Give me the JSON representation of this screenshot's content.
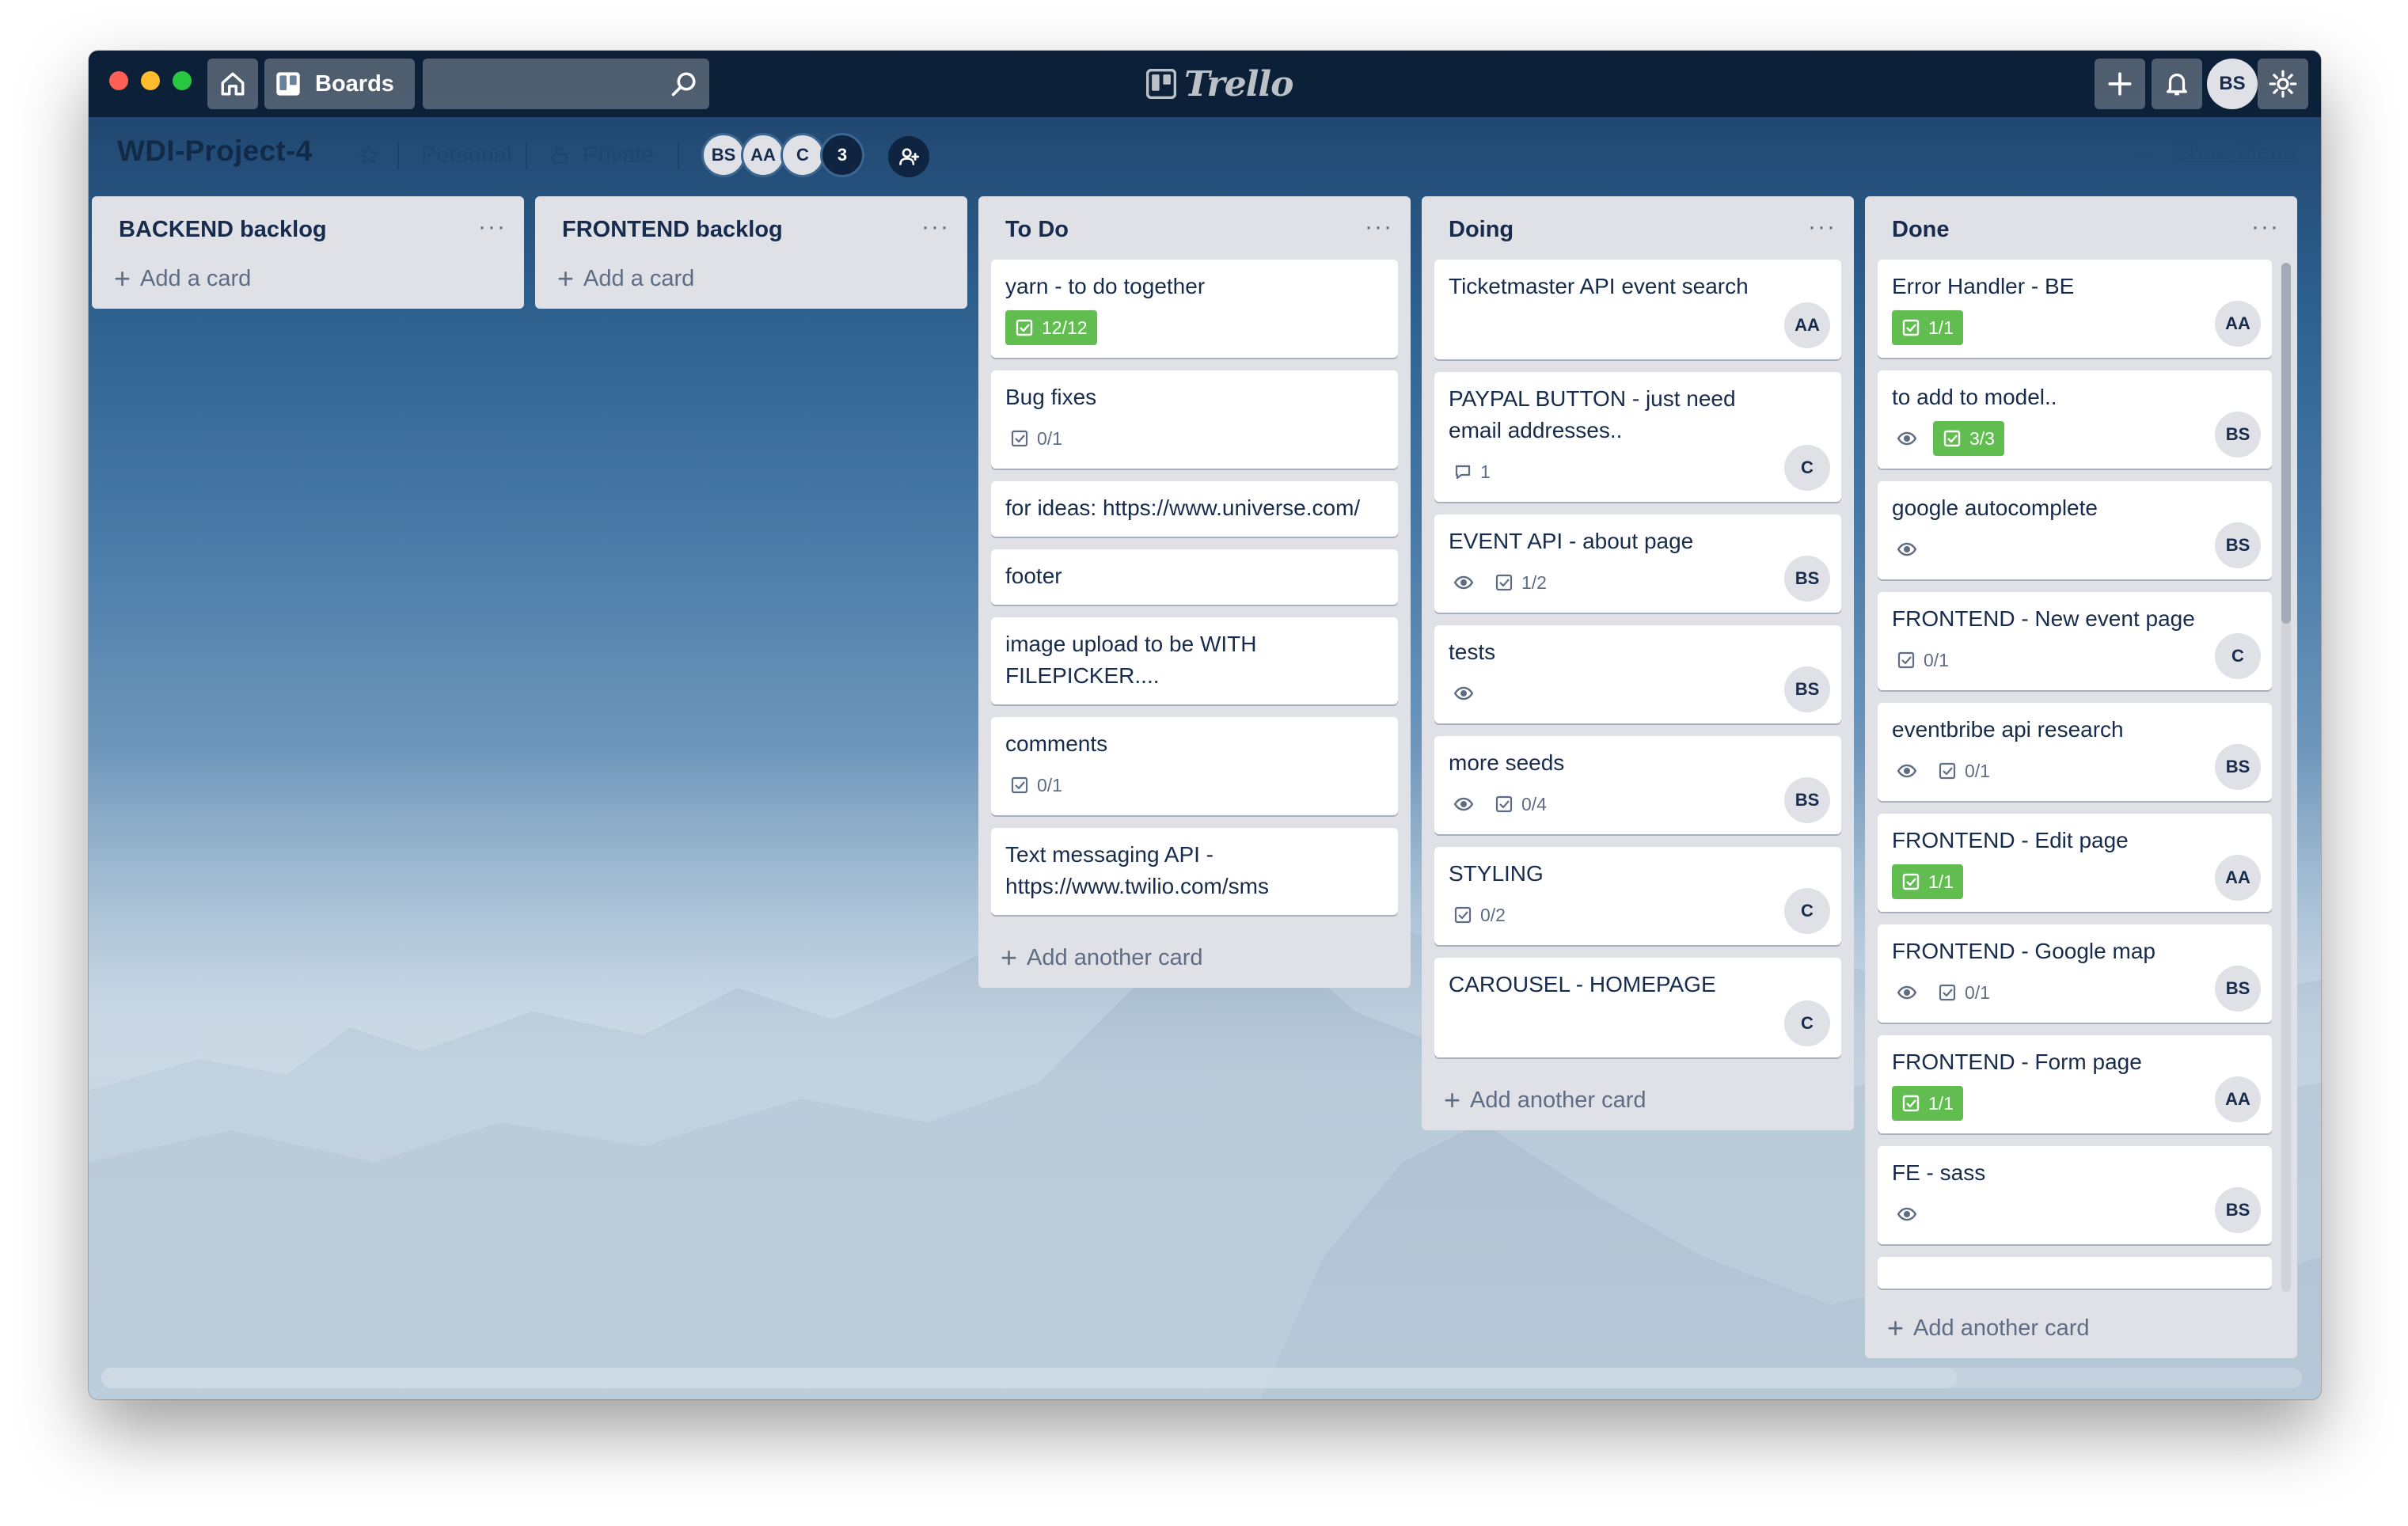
{
  "app": {
    "logo_text": "Trello"
  },
  "topbar": {
    "boards_label": "Boards",
    "search_value": "",
    "search_placeholder": "",
    "user_initials": "BS"
  },
  "board": {
    "title": "WDI-Project-4",
    "team": "Personal",
    "visibility": "Private",
    "members": [
      "BS",
      "AA",
      "C"
    ],
    "member_count": "3",
    "show_menu": "Show Menu"
  },
  "lists": [
    {
      "title": "BACKEND backlog",
      "add_label": "Add a card",
      "cards": []
    },
    {
      "title": "FRONTEND backlog",
      "add_label": "Add a card",
      "cards": []
    },
    {
      "title": "To Do",
      "add_label": "Add another card",
      "cards": [
        {
          "title": "yarn - to do together",
          "checklist": "12/12",
          "checklist_done": true
        },
        {
          "title": "Bug fixes",
          "checklist": "0/1"
        },
        {
          "title": "for ideas: https://www.universe.com/"
        },
        {
          "title": "footer"
        },
        {
          "title": "image upload to be WITH FILEPICKER...."
        },
        {
          "title": "comments",
          "checklist": "0/1"
        },
        {
          "title": "Text messaging API - https://www.twilio.com/sms"
        }
      ]
    },
    {
      "title": "Doing",
      "add_label": "Add another card",
      "cards": [
        {
          "title": "Ticketmaster API event search",
          "member": "AA"
        },
        {
          "title": "PAYPAL BUTTON - just need email addresses..",
          "comments": "1",
          "member": "C"
        },
        {
          "title": "EVENT API - about page",
          "watching": true,
          "checklist": "1/2",
          "member": "BS"
        },
        {
          "title": "tests",
          "watching": true,
          "member": "BS"
        },
        {
          "title": "more seeds",
          "watching": true,
          "checklist": "0/4",
          "member": "BS"
        },
        {
          "title": "STYLING",
          "checklist": "0/2",
          "member": "C"
        },
        {
          "title": "CAROUSEL - HOMEPAGE",
          "member": "C"
        }
      ]
    },
    {
      "title": "Done",
      "add_label": "Add another card",
      "cards": [
        {
          "title": "Error Handler - BE",
          "checklist": "1/1",
          "checklist_done": true,
          "member": "AA"
        },
        {
          "title": "to add to model..",
          "watching": true,
          "checklist": "3/3",
          "checklist_done": true,
          "member": "BS"
        },
        {
          "title": "google autocomplete",
          "watching": true,
          "member": "BS"
        },
        {
          "title": "FRONTEND - New event page",
          "checklist": "0/1",
          "member": "C"
        },
        {
          "title": "eventbribe api research",
          "watching": true,
          "checklist": "0/1",
          "member": "BS"
        },
        {
          "title": "FRONTEND - Edit page",
          "checklist": "1/1",
          "checklist_done": true,
          "member": "AA"
        },
        {
          "title": "FRONTEND - Google map",
          "watching": true,
          "checklist": "0/1",
          "member": "BS"
        },
        {
          "title": "FRONTEND - Form page",
          "checklist": "1/1",
          "checklist_done": true,
          "member": "AA"
        },
        {
          "title": "FE - sass",
          "watching": true,
          "member": "BS"
        }
      ]
    }
  ],
  "colors": {
    "checklist_done": "#61bd4f",
    "list_bg": "#dfe1e6",
    "card_bg": "#ffffff",
    "text": "#172b4d"
  }
}
